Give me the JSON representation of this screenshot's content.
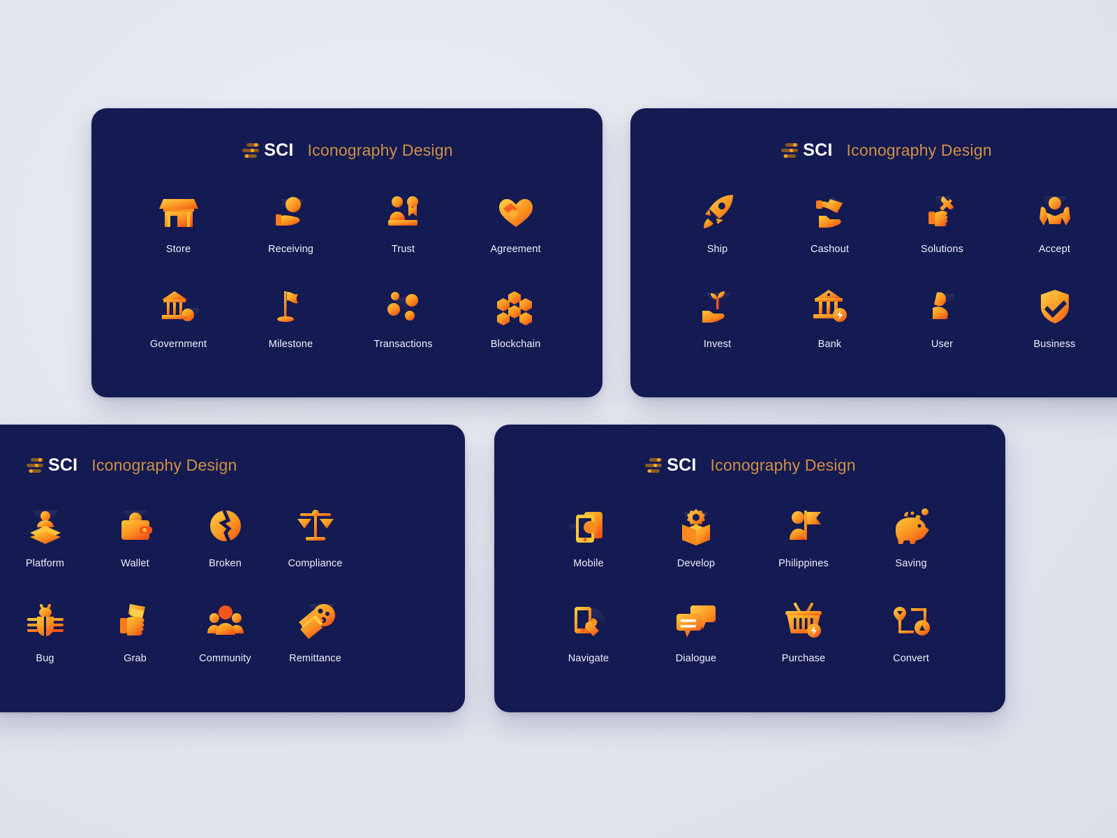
{
  "brand": {
    "name": "SCI",
    "logo_icon": "sci-bars-logo-icon",
    "title": "Iconography Design",
    "title_color": "#cf9144",
    "name_color": "#ffffff"
  },
  "theme": {
    "page_background": "#e4e6ef",
    "card_background": "#141a52",
    "label_color": "#eef0f8",
    "icon_gradient_start": "#ffc83d",
    "icon_gradient_end": "#f4561a"
  },
  "cards": [
    {
      "id": "card-1",
      "brand_name": "SCI",
      "title": "Iconography Design",
      "icons": [
        {
          "label": "Store",
          "icon": "store-icon"
        },
        {
          "label": "Receiving",
          "icon": "receiving-hand-icon"
        },
        {
          "label": "Trust",
          "icon": "trust-people-badge-icon"
        },
        {
          "label": "Agreement",
          "icon": "handshake-heart-icon"
        },
        {
          "label": "Government",
          "icon": "government-building-icon"
        },
        {
          "label": "Milestone",
          "icon": "milestone-flag-icon"
        },
        {
          "label": "Transactions",
          "icon": "transactions-nodes-icon"
        },
        {
          "label": "Blockchain",
          "icon": "blockchain-cubes-icon"
        }
      ]
    },
    {
      "id": "card-2",
      "brand_name": "SCI",
      "title": "Iconography Design",
      "icons": [
        {
          "label": "Ship",
          "icon": "rocket-ship-icon"
        },
        {
          "label": "Cashout",
          "icon": "cashout-hand-money-icon"
        },
        {
          "label": "Solutions",
          "icon": "wrench-thumbsup-icon"
        },
        {
          "label": "Accept",
          "icon": "accept-hands-icon"
        },
        {
          "label": "Invest",
          "icon": "invest-sprout-hand-icon"
        },
        {
          "label": "Bank",
          "icon": "bank-bolt-icon"
        },
        {
          "label": "User",
          "icon": "user-person-icon"
        },
        {
          "label": "Business",
          "icon": "shield-check-icon"
        }
      ]
    },
    {
      "id": "card-3",
      "brand_name": "SCI",
      "title": "Iconography Design",
      "icons": [
        {
          "label": "Platform",
          "icon": "platform-layers-person-icon"
        },
        {
          "label": "Wallet",
          "icon": "wallet-icon"
        },
        {
          "label": "Broken",
          "icon": "broken-coin-icon"
        },
        {
          "label": "Compliance",
          "icon": "scales-balance-icon"
        },
        {
          "label": "Bug",
          "icon": "bug-icon"
        },
        {
          "label": "Grab",
          "icon": "grab-hand-cash-icon"
        },
        {
          "label": "Community",
          "icon": "community-group-icon"
        },
        {
          "label": "Remittance",
          "icon": "remittance-globe-cash-icon"
        }
      ]
    },
    {
      "id": "card-4",
      "brand_name": "SCI",
      "title": "Iconography Design",
      "icons": [
        {
          "label": "Mobile",
          "icon": "mobile-phone-icon"
        },
        {
          "label": "Develop",
          "icon": "develop-box-gear-icon"
        },
        {
          "label": "Philippines",
          "icon": "philippines-person-flag-icon"
        },
        {
          "label": "Saving",
          "icon": "piggy-bank-icon"
        },
        {
          "label": "Navigate",
          "icon": "navigate-tap-phone-icon"
        },
        {
          "label": "Dialogue",
          "icon": "dialogue-chat-bubbles-icon"
        },
        {
          "label": "Purchase",
          "icon": "purchase-basket-bolt-icon"
        },
        {
          "label": "Convert",
          "icon": "convert-nodes-icon"
        }
      ]
    }
  ]
}
